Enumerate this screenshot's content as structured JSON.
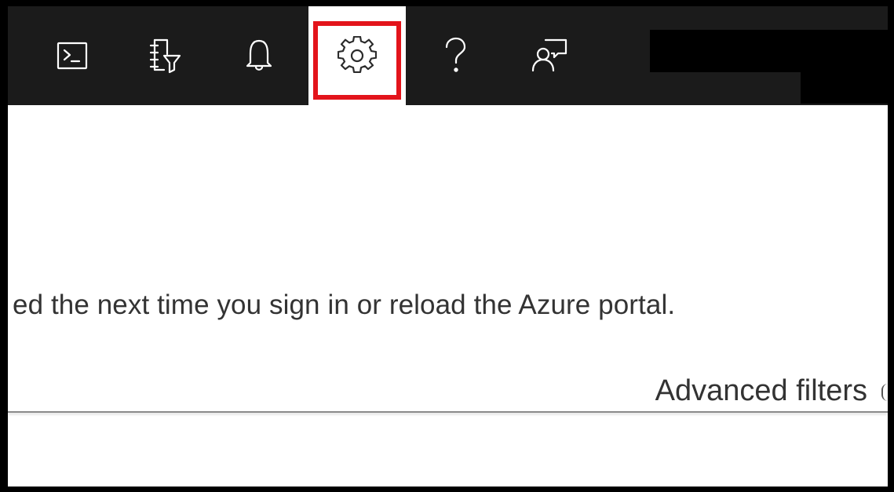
{
  "topbar": {
    "icons": [
      {
        "name": "cloud-shell-icon",
        "glyph": "terminal"
      },
      {
        "name": "directory-filter-icon",
        "glyph": "book-filter"
      },
      {
        "name": "notifications-icon",
        "glyph": "bell"
      },
      {
        "name": "settings-icon",
        "glyph": "gear",
        "active": true,
        "highlighted": true
      },
      {
        "name": "help-icon",
        "glyph": "question"
      },
      {
        "name": "feedback-icon",
        "glyph": "person-chat"
      }
    ],
    "background_color": "#1b1b1b",
    "highlight_color": "#e3141b"
  },
  "content": {
    "notice_text": "ed the next time you sign in or reload the Azure portal.",
    "advanced_filters_label": "Advanced filters"
  }
}
